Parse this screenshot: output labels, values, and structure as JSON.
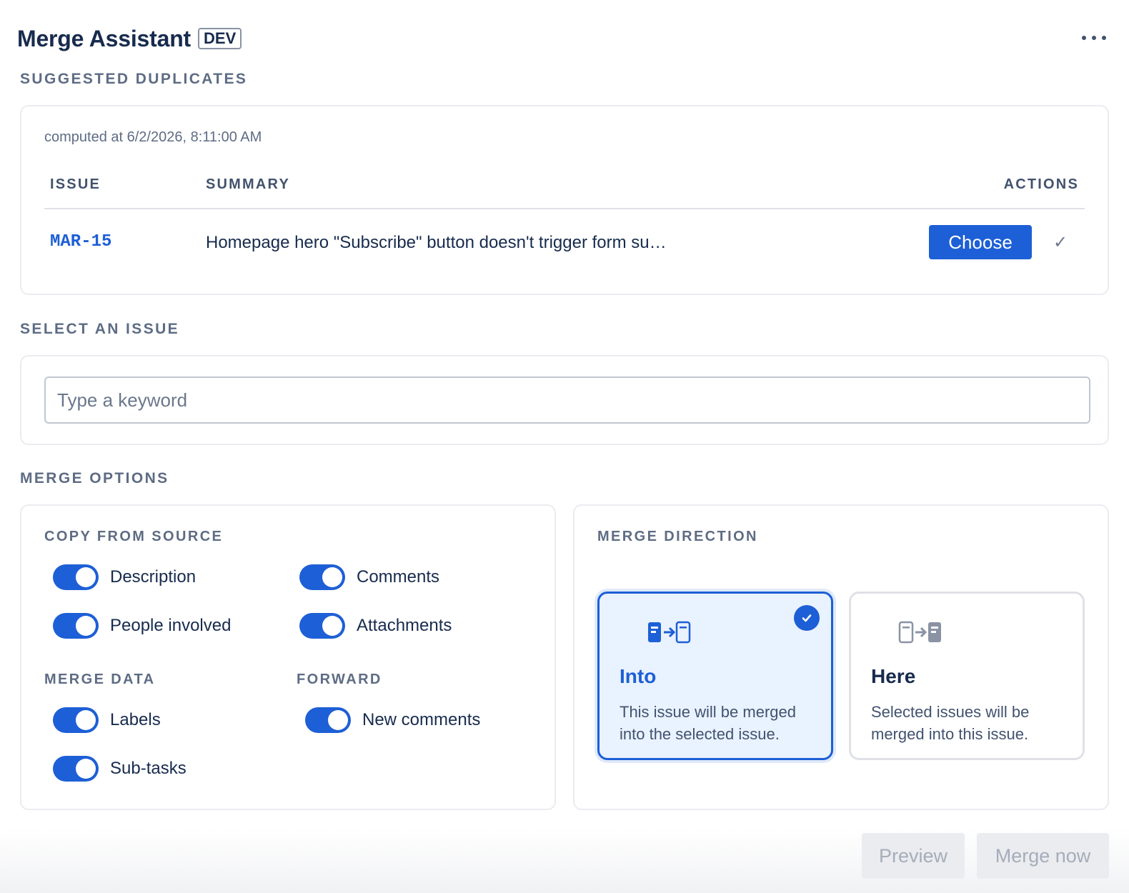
{
  "header": {
    "title": "Merge Assistant",
    "env_badge": "DEV"
  },
  "suggested": {
    "section_title": "SUGGESTED DUPLICATES",
    "computed_at": "computed at 6/2/2026, 8:11:00 AM",
    "columns": {
      "issue": "ISSUE",
      "summary": "SUMMARY",
      "actions": "ACTIONS"
    },
    "rows": [
      {
        "key": "MAR-15",
        "summary": "Homepage hero \"Subscribe\" button doesn't trigger form su…",
        "action_label": "Choose",
        "check_glyph": "✓"
      }
    ]
  },
  "select_issue": {
    "section_title": "SELECT AN ISSUE",
    "placeholder": "Type a keyword",
    "value": ""
  },
  "merge_options": {
    "section_title": "MERGE OPTIONS",
    "copy_from_source": {
      "title": "COPY FROM SOURCE",
      "toggles": [
        {
          "label": "Description",
          "on": true
        },
        {
          "label": "Comments",
          "on": true
        },
        {
          "label": "People involved",
          "on": true
        },
        {
          "label": "Attachments",
          "on": true
        }
      ]
    },
    "merge_data": {
      "title": "MERGE DATA",
      "toggles": [
        {
          "label": "Labels",
          "on": true
        },
        {
          "label": "Sub-tasks",
          "on": true
        }
      ]
    },
    "forward": {
      "title": "FORWARD",
      "toggles": [
        {
          "label": "New comments",
          "on": true
        }
      ]
    },
    "merge_direction": {
      "title": "MERGE DIRECTION",
      "options": [
        {
          "title": "Into",
          "description": "This issue will be merged into the selected issue.",
          "selected": true
        },
        {
          "title": "Here",
          "description": "Selected issues will be merged into this issue.",
          "selected": false
        }
      ]
    }
  },
  "footer": {
    "preview_label": "Preview",
    "merge_now_label": "Merge now"
  },
  "colors": {
    "accent": "#1d5fd6",
    "section_heading": "#5e6c84",
    "text": "#172b4d",
    "disabled_bg": "#ebecf0",
    "disabled_text": "#a5adba"
  },
  "icons": [
    "more-horizontal-icon",
    "check-icon",
    "merge-into-icon",
    "merge-here-icon",
    "selected-check-icon"
  ]
}
